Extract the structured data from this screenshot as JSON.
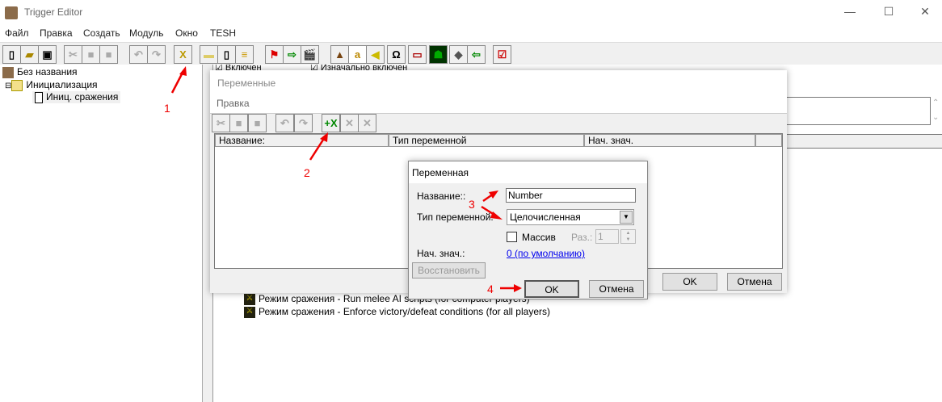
{
  "window": {
    "title": "Trigger Editor",
    "minimize": "—",
    "maximize": "☐",
    "close": "✕"
  },
  "menu": [
    "Файл",
    "Правка",
    "Создать",
    "Модуль",
    "Окно",
    "TESH"
  ],
  "toolbar_icons": [
    "new-icon",
    "open-icon",
    "save-icon",
    "cut-icon",
    "copy-icon",
    "paste-icon",
    "undo-icon",
    "redo-icon",
    "new-variables-icon",
    "new-category-icon",
    "new-trigger-icon",
    "new-comment-icon",
    "flag-icon",
    "import-icon",
    "clapper-icon",
    "terrain-icon",
    "text-icon",
    "sound-icon",
    "object-icon",
    "unit-icon",
    "monster-icon",
    "cube-icon",
    "export-icon",
    "checklist-icon"
  ],
  "tree": {
    "root": "Без названия",
    "folder": "Инициализация",
    "trigger": "Иниц. сражения"
  },
  "right": {
    "enabled": "Включен",
    "initially_enabled": "Изначально включен",
    "actions": [
      "Режим сражения - Run melee AI scripts (for computer players)",
      "Режим сражения - Enforce victory/defeat conditions (for all players)"
    ]
  },
  "variables_window": {
    "title": "Переменные",
    "menu": "Правка",
    "columns": [
      "Название:",
      "Тип переменной",
      "Нач. знач.",
      ""
    ],
    "ok": "OK",
    "cancel": "Отмена"
  },
  "variable_dialog": {
    "title": "Переменная",
    "name_label": "Название::",
    "name_value": "Number",
    "type_label": "Тип переменной:",
    "type_value": "Целочисленная",
    "array_label": "Массив",
    "array_checked": false,
    "size_label": "Раз.:",
    "size_value": "1",
    "initial_label": "Нач. знач.:",
    "initial_value": "0 (по умолчанию)",
    "restore": "Восстановить",
    "ok": "OK",
    "cancel": "Отмена"
  },
  "annotations": [
    "1",
    "2",
    "3",
    "4"
  ],
  "colors": {
    "annotation": "#ee0000",
    "link": "#0000ee"
  }
}
